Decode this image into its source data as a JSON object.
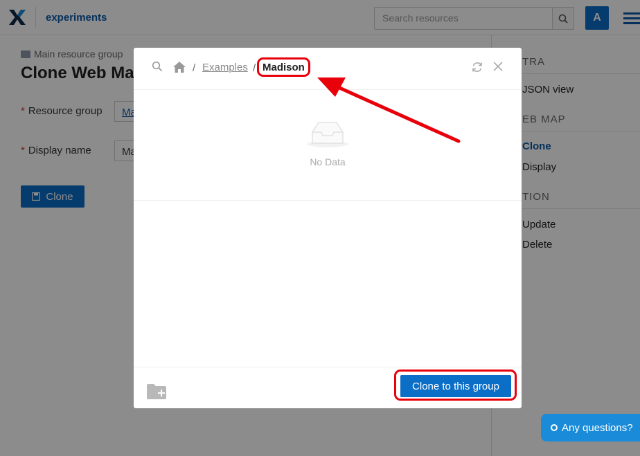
{
  "header": {
    "app_title": "experiments",
    "search_placeholder": "Search resources",
    "avatar_letter": "A"
  },
  "page": {
    "breadcrumb": "Main resource group",
    "title": "Clone Web Map",
    "form": {
      "resource_group_label": "Resource group",
      "resource_group_value": "Ma",
      "display_name_label": "Display name",
      "display_name_value": "Ma",
      "required_mark": "*"
    },
    "clone_button": "Clone"
  },
  "right_panel": {
    "sections": [
      {
        "heading": "TRA",
        "items": [
          "JSON view"
        ]
      },
      {
        "heading": "EB MAP",
        "items": [
          "Clone",
          "Display"
        ]
      },
      {
        "heading": "TION",
        "items": [
          "Update",
          "Delete"
        ]
      }
    ]
  },
  "modal": {
    "sep": "/",
    "crumbs": [
      "Examples"
    ],
    "current": "Madison",
    "empty_text": "No Data",
    "action_button": "Clone to this group"
  },
  "chat": {
    "label": "Any questions?"
  },
  "colors": {
    "accent": "#0b6ec7",
    "annotation": "#e8000b"
  }
}
